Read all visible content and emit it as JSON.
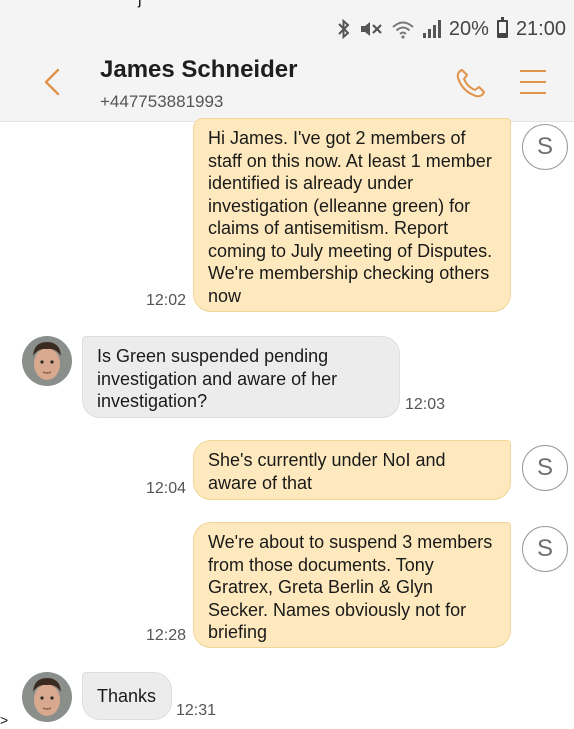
{
  "top_fragment": "j",
  "status_bar": {
    "bluetooth_icon": "bluetooth-icon",
    "mute_icon": "mute-icon",
    "wifi_icon": "wifi-icon",
    "battery_percent": "20%",
    "battery_level": 0.2,
    "clock": "21:00"
  },
  "header": {
    "contact_name": "James Schneider",
    "contact_number": "+447753881993",
    "accent_color": "#e0934b"
  },
  "messages": [
    {
      "direction": "outgoing",
      "text": "Hi James. I've got 2 members of staff on this now. At least 1 member identified is already under investigation (elleanne green) for claims of antisemitism. Report coming to July meeting of Disputes. We're membership checking others now",
      "time": "12:02",
      "sim_label": "S"
    },
    {
      "direction": "incoming",
      "text": "Is Green suspended pending investigation and aware of her investigation?",
      "time": "12:03"
    },
    {
      "direction": "outgoing",
      "text": "She's currently under NoI and aware of that",
      "time": "12:04",
      "sim_label": "S"
    },
    {
      "direction": "outgoing",
      "text": "We're about to suspend 3 members from those documents. Tony Gratrex, Greta Berlin & Glyn Secker. Names obviously not for briefing",
      "time": "12:28",
      "sim_label": "S"
    },
    {
      "direction": "incoming",
      "text": "Thanks",
      "time": "12:31"
    }
  ],
  "bottom_fragment": ">",
  "colors": {
    "outgoing_bubble": "#fde9bd",
    "incoming_bubble": "#ececec",
    "header_bg": "#f4f4f4"
  }
}
